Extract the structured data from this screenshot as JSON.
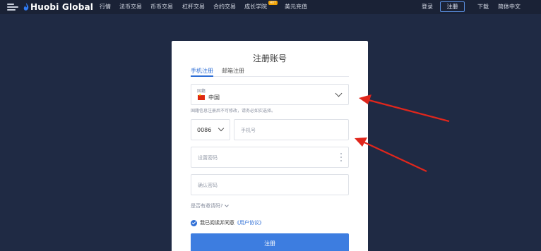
{
  "nav": {
    "logo_text": "Huobi Global",
    "items": [
      "行情",
      "法币交易",
      "币币交易",
      "杠杆交易",
      "合约交易",
      "成长学院",
      "美元充值"
    ],
    "hot_badge": "HOT",
    "login": "登录",
    "register": "注册",
    "download": "下载",
    "language": "简体中文"
  },
  "form": {
    "title": "注册账号",
    "tab_phone": "手机注册",
    "tab_email": "邮箱注册",
    "country_label": "国籍",
    "country_value": "中国",
    "country_hint": "国籍信息注册后不可修改，请务必如实选择。",
    "area_code": "0086",
    "phone_placeholder": "手机号",
    "password_placeholder": "设置密码",
    "confirm_placeholder": "确认密码",
    "invite_question": "是否有邀请码?",
    "agree_text": "我已阅读并同意",
    "agreement_link": "《用户协议》",
    "submit": "注册"
  },
  "colors": {
    "background": "#1f2a44",
    "topbar": "#1a2236",
    "accent": "#3d7de0",
    "arrow": "#e0261c"
  }
}
